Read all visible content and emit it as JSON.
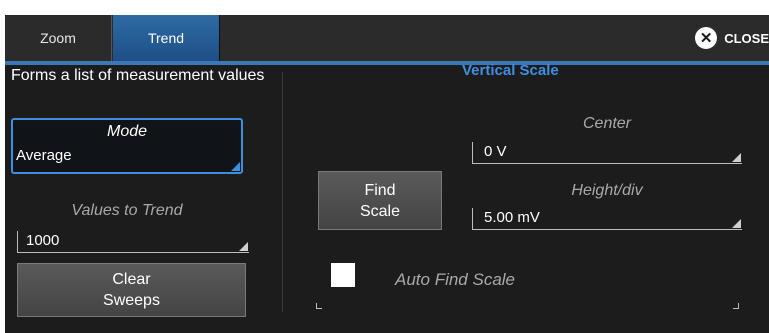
{
  "tabs": [
    {
      "label": "Zoom",
      "active": false
    },
    {
      "label": "Trend",
      "active": true
    }
  ],
  "close": {
    "label": "CLOSE",
    "icon": "close-x-icon"
  },
  "description": "Forms a list of measurement values",
  "mode": {
    "label": "Mode",
    "value": "Average"
  },
  "values_to_trend": {
    "label": "Values to Trend",
    "value": "1000"
  },
  "clear_sweeps": {
    "line1": "Clear",
    "line2": "Sweeps"
  },
  "vertical_scale": {
    "title": "Vertical Scale",
    "find_scale": {
      "line1": "Find",
      "line2": "Scale"
    },
    "center": {
      "label": "Center",
      "value": "0 V"
    },
    "height_div": {
      "label": "Height/div",
      "value": "5.00 mV"
    },
    "auto_find_scale": {
      "label": "Auto Find Scale",
      "checked": false
    }
  },
  "colors": {
    "accent": "#3f8fe0",
    "tab_active": "#2f6aa6",
    "panel_bg": "#1c1c1c"
  }
}
